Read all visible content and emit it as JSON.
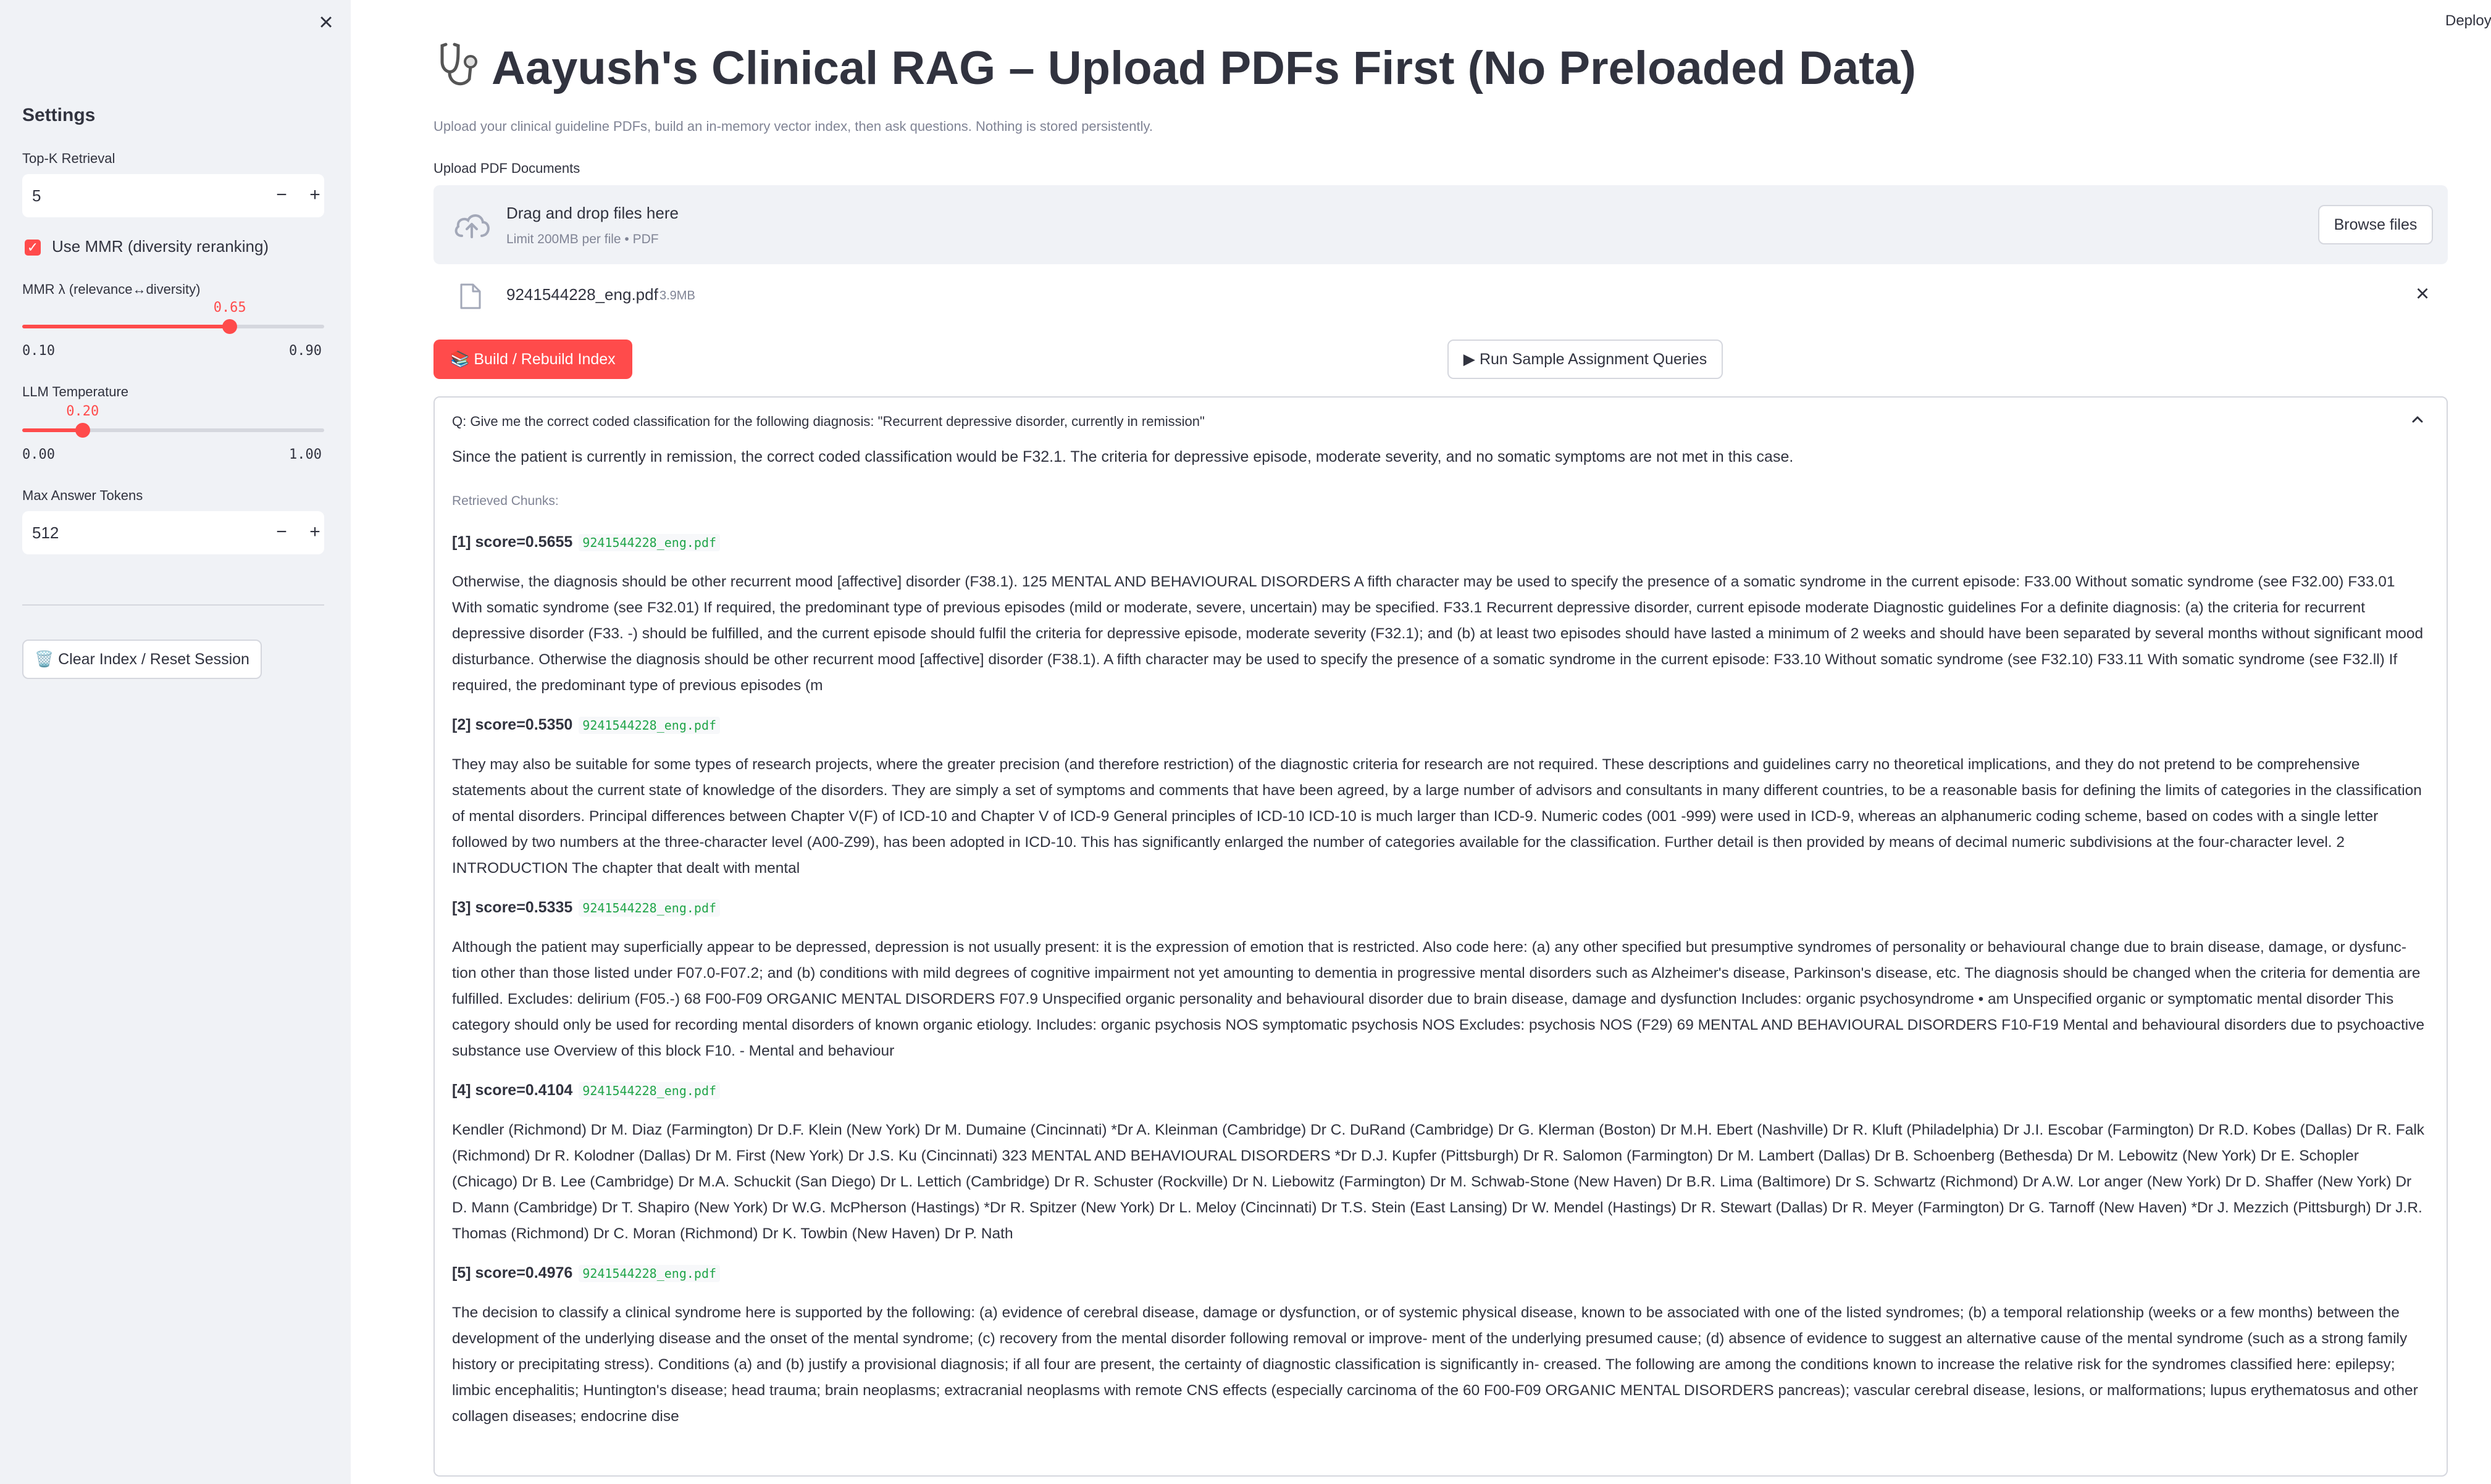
{
  "sidebar": {
    "close_icon": "×",
    "settings_title": "Settings",
    "topk": {
      "label": "Top-K Retrieval",
      "value": "5",
      "minus": "−",
      "plus": "+"
    },
    "use_mmr": {
      "label": "Use MMR (diversity reranking)",
      "checked": true,
      "check_glyph": "✓"
    },
    "mmr_lambda": {
      "label": "MMR λ (relevance↔diversity)",
      "value": "0.65",
      "min": "0.10",
      "max": "0.90",
      "fraction": 0.6875
    },
    "llm_temperature": {
      "label": "LLM Temperature",
      "value": "0.20",
      "min": "0.00",
      "max": "1.00",
      "fraction": 0.2
    },
    "max_tokens": {
      "label": "Max Answer Tokens",
      "value": "512",
      "minus": "−",
      "plus": "+"
    },
    "clear_button": "🗑️ Clear Index / Reset Session"
  },
  "header": {
    "deploy": "Deploy",
    "title": "Aayush's Clinical RAG – Upload PDFs First (No Preloaded Data)",
    "subtitle": "Upload your clinical guideline PDFs, build an in-memory vector index, then ask questions. Nothing is stored persistently."
  },
  "uploader": {
    "label": "Upload PDF Documents",
    "drop_text": "Drag and drop files here",
    "limit_text": "Limit 200MB per file • PDF",
    "browse": "Browse files",
    "file": {
      "name": "9241544228_eng.pdf",
      "size": "3.9MB",
      "remove": "×"
    }
  },
  "actions": {
    "build": "📚 Build / Rebuild Index",
    "sample": "▶ Run Sample Assignment Queries"
  },
  "result": {
    "question": "Q: Give me the correct coded classification for the following diagnosis: \"Recurrent depressive disorder, currently in remission\"",
    "answer": "Since the patient is currently in remission, the correct coded classification would be F32.1. The criteria for depressive episode, moderate severity, and no somatic symptoms are not met in this case.",
    "retrieved_label": "Retrieved Chunks:",
    "chunks": [
      {
        "head": "[1] score=0.5655",
        "source": "9241544228_eng.pdf",
        "text": "Otherwise, the diagnosis should be other recurrent mood [affective] disorder (F38.1). 125 MENTAL AND BEHAVIOURAL DISORDERS A fifth character may be used to specify the presence of a somatic syndrome in the current episode: F33.00 Without somatic syndrome (see F32.00) F33.01 With somatic syndrome (see F32.01) If required, the predominant type of previous episodes (mild or moderate, severe, uncertain) may be specified. F33.1 Recurrent depressive disorder, current episode moderate Diagnostic guidelines For a definite diagnosis: (a) the criteria for recurrent depressive disorder (F33. -) should be fulfilled, and the current episode should fulfil the criteria for depressive episode, moderate severity (F32.1); and (b) at least two episodes should have lasted a minimum of 2 weeks and should have been separated by several months without significant mood disturbance. Otherwise the diagnosis should be other recurrent mood [affective] disorder (F38.1). A fifth character may be used to specify the presence of a somatic syndrome in the current episode: F33.10 Without somatic syndrome (see F32.10) F33.11 With somatic syndrome (see F32.ll) If required, the predominant type of previous episodes (m"
      },
      {
        "head": "[2] score=0.5350",
        "source": "9241544228_eng.pdf",
        "text": "They may also be suitable for some types of research projects, where the greater precision (and therefore restriction) of the diagnostic criteria for research are not required. These descriptions and guidelines carry no theoretical implications, and they do not pretend to be comprehensive statements about the current state of knowledge of the disorders. They are simply a set of symptoms and comments that have been agreed, by a large number of advisors and consultants in many different countries, to be a reasonable basis for defining the limits of categories in the classification of mental disorders. Principal differences between Chapter V(F) of ICD-10 and Chapter V of ICD-9 General principles of ICD-10 ICD-10 is much larger than ICD-9. Numeric codes (001 -999) were used in ICD-9, whereas an alphanumeric coding scheme, based on codes with a single letter followed by two numbers at the three-character level (A00-Z99), has been adopted in ICD-10. This has significantly enlarged the number of categories available for the classification. Further detail is then provided by means of decimal numeric subdivisions at the four-character level. 2 INTRODUCTION The chapter that dealt with mental"
      },
      {
        "head": "[3] score=0.5335",
        "source": "9241544228_eng.pdf",
        "text": "Although the patient may superficially appear to be depressed, depression is not usually present: it is the expression of emotion that is restricted. Also code here: (a) any other specified but presumptive syndromes of personality or behavioural change due to brain disease, damage, or dysfunc- tion other than those listed under F07.0-F07.2; and (b) conditions with mild degrees of cognitive impairment not yet amounting to dementia in progressive mental disorders such as Alzheimer's disease, Parkinson's disease, etc. The diagnosis should be changed when the criteria for dementia are fulfilled. Excludes: delirium (F05.-) 68 F00-F09 ORGANIC MENTAL DISORDERS F07.9 Unspecified organic personality and behavioural disorder due to brain disease, damage and dysfunction Includes: organic psychosyndrome • am Unspecified organic or symptomatic mental disorder This category should only be used for recording mental disorders of known organic etiology. Includes: organic psychosis NOS symptomatic psychosis NOS Excludes: psychosis NOS (F29) 69 MENTAL AND BEHAVIOURAL DISORDERS F10-F19 Mental and behavioural disorders due to psychoactive substance use Overview of this block F10. - Mental and behaviour"
      },
      {
        "head": "[4] score=0.4104",
        "source": "9241544228_eng.pdf",
        "text": "Kendler (Richmond) Dr M. Diaz (Farmington) Dr D.F. Klein (New York) Dr M. Dumaine (Cincinnati) *Dr A. Kleinman (Cambridge) Dr C. DuRand (Cambridge) Dr G. Klerman (Boston) Dr M.H. Ebert (Nashville) Dr R. Kluft (Philadelphia) Dr J.I. Escobar (Farmington) Dr R.D. Kobes (Dallas) Dr R. Falk (Richmond) Dr R. Kolodner (Dallas) Dr M. First (New York) Dr J.S. Ku (Cincinnati) 323 MENTAL AND BEHAVIOURAL DISORDERS *Dr D.J. Kupfer (Pittsburgh) Dr R. Salomon (Farmington) Dr M. Lambert (Dallas) Dr B. Schoenberg (Bethesda) Dr M. Lebowitz (New York) Dr E. Schopler (Chicago) Dr B. Lee (Cambridge) Dr M.A. Schuckit (San Diego) Dr L. Lettich (Cambridge) Dr R. Schuster (Rockville) Dr N. Liebowitz (Farmington) Dr M. Schwab-Stone (New Haven) Dr B.R. Lima (Baltimore) Dr S. Schwartz (Richmond) Dr A.W. Lor anger (New York) Dr D. Shaffer (New York) Dr D. Mann (Cambridge) Dr T. Shapiro (New York) Dr W.G. McPherson (Hastings) *Dr R. Spitzer (New York) Dr L. Meloy (Cincinnati) Dr T.S. Stein (East Lansing) Dr W. Mendel (Hastings) Dr R. Stewart (Dallas) Dr R. Meyer (Farmington) Dr G. Tarnoff (New Haven) *Dr J. Mezzich (Pittsburgh) Dr J.R. Thomas (Richmond) Dr C. Moran (Richmond) Dr K. Towbin (New Haven) Dr P. Nath"
      },
      {
        "head": "[5] score=0.4976",
        "source": "9241544228_eng.pdf",
        "text": "The decision to classify a clinical syndrome here is supported by the following: (a) evidence of cerebral disease, damage or dysfunction, or of systemic physical disease, known to be associated with one of the listed syndromes; (b) a temporal relationship (weeks or a few months) between the development of the underlying disease and the onset of the mental syndrome; (c) recovery from the mental disorder following removal or improve- ment of the underlying presumed cause; (d) absence of evidence to suggest an alternative cause of the mental syndrome (such as a strong family history or precipitating stress). Conditions (a) and (b) justify a provisional diagnosis; if all four are present, the certainty of diagnostic classification is significantly in- creased. The following are among the conditions known to increase the relative risk for the syndromes classified here: epilepsy; limbic encephalitis; Huntington's disease; head trauma; brain neoplasms; extracranial neoplasms with remote CNS effects (especially carcinoma of the 60 F00-F09 ORGANIC MENTAL DISORDERS pancreas); vascular cerebral disease, lesions, or malformations; lupus erythematosus and other collagen diseases; endocrine dise"
      }
    ]
  },
  "colors": {
    "accent": "#ff4b4b",
    "sidebar_bg": "#f0f2f6",
    "source_green": "#21a54a"
  },
  "icons": [
    "close-icon",
    "check-icon",
    "stethoscope-icon",
    "cloud-upload-icon",
    "file-icon",
    "chevron-up-icon"
  ]
}
